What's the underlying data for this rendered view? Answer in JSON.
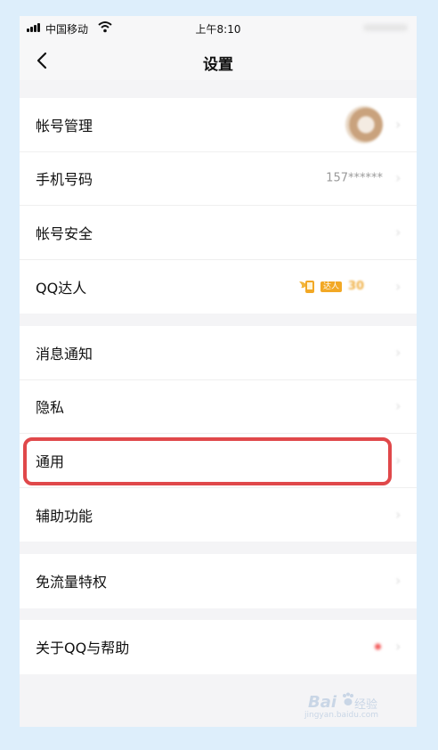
{
  "status_bar": {
    "carrier": "中国移动",
    "time": "上午8:10"
  },
  "nav": {
    "title": "设置"
  },
  "groups": [
    {
      "items": [
        {
          "label": "帐号管理"
        },
        {
          "label": "手机号码",
          "value": "157******"
        },
        {
          "label": "帐号安全"
        },
        {
          "label": "QQ达人",
          "badge_text": "达人",
          "badge_days": "30"
        }
      ]
    },
    {
      "items": [
        {
          "label": "消息通知"
        },
        {
          "label": "隐私"
        },
        {
          "label": "通用"
        },
        {
          "label": "辅助功能"
        }
      ]
    },
    {
      "items": [
        {
          "label": "免流量特权"
        }
      ]
    },
    {
      "items": [
        {
          "label": "关于QQ与帮助"
        }
      ]
    }
  ],
  "watermark": {
    "brand": "Bai",
    "suffix": "经验",
    "url": "jingyan.baidu.com"
  },
  "colors": {
    "highlight": "#e0484a",
    "badge": "#f2a825",
    "page_bg": "#f4f4f6"
  }
}
